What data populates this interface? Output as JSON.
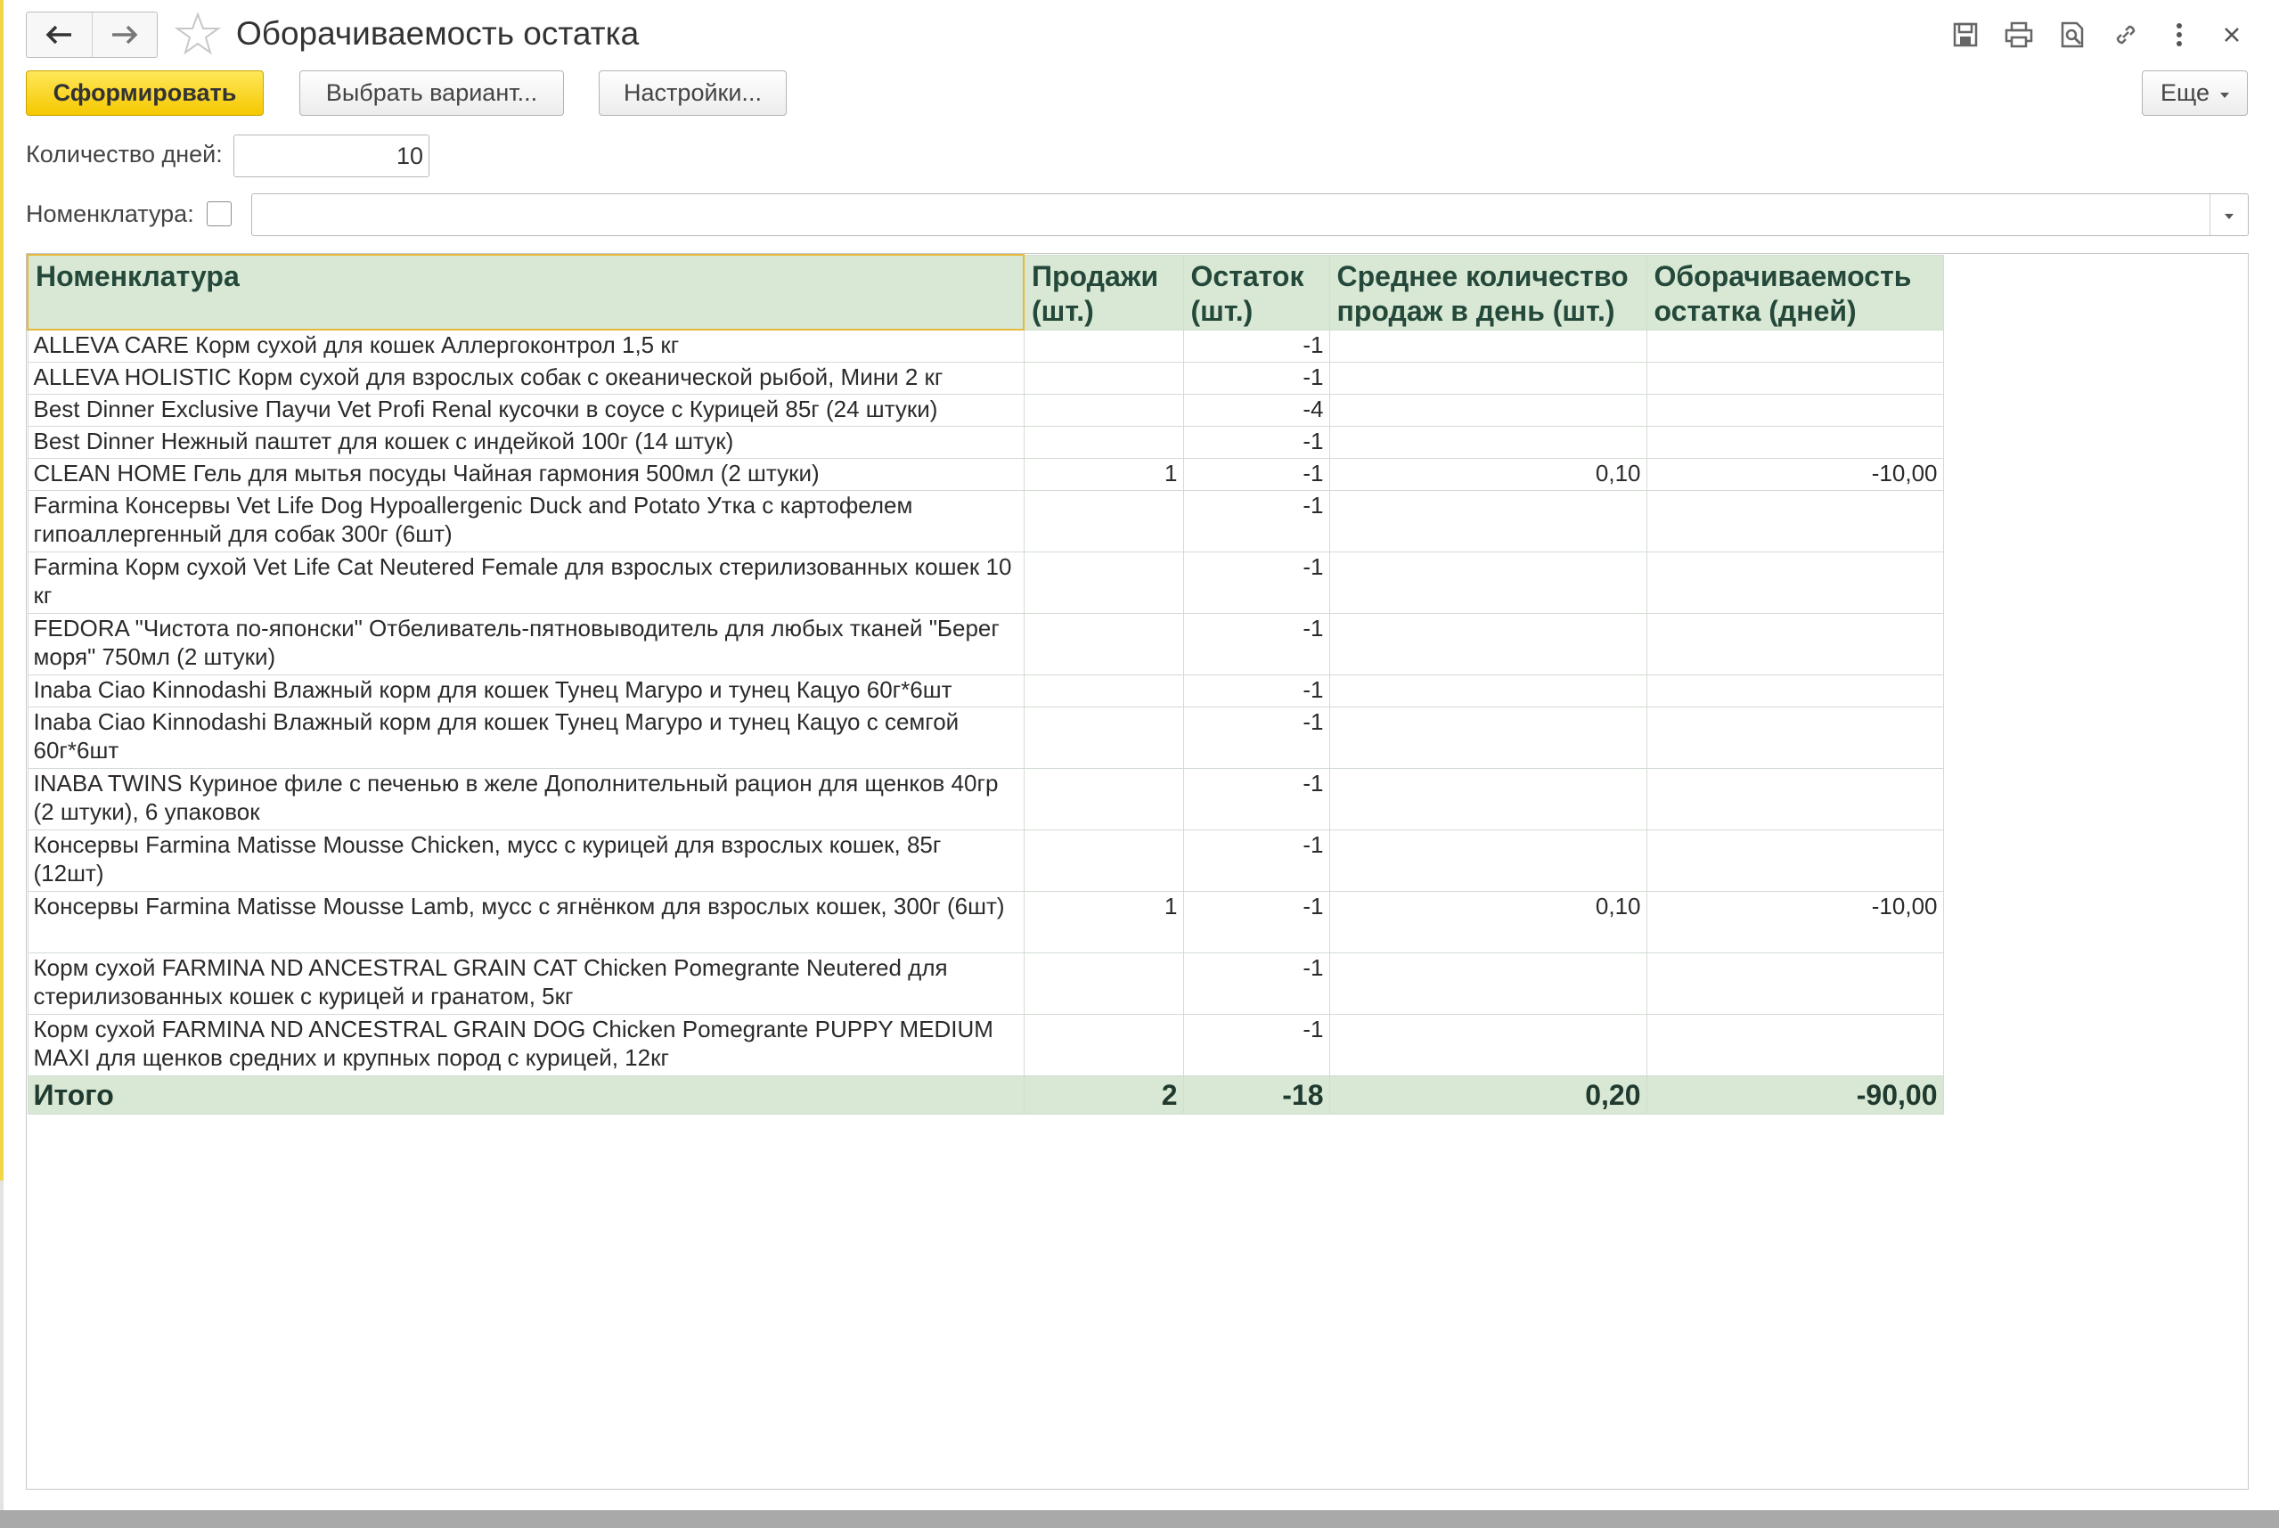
{
  "window": {
    "title": "Оборачиваемость остатка"
  },
  "toolbar": {
    "generate_label": "Сформировать",
    "variant_label": "Выбрать вариант...",
    "settings_label": "Настройки...",
    "more_label": "Еще"
  },
  "filters": {
    "days_label": "Количество дней:",
    "days_value": "10",
    "nomenclature_label": "Номенклатура:",
    "nomenclature_value": ""
  },
  "report": {
    "columns": {
      "name": "Номенклатура",
      "sales": "Продажи (шт.)",
      "stock": "Остаток (шт.)",
      "avg": "Среднее количество продаж в день (шт.)",
      "turnover": "Оборачиваемость остатка (дней)"
    },
    "rows": [
      {
        "name": "ALLEVA CARE Корм сухой для кошек Аллергоконтрол 1,5 кг",
        "sales": "",
        "stock": "-1",
        "avg": "",
        "turnover": ""
      },
      {
        "name": "ALLEVA HOLISTIC Корм сухой для взрослых собак с океанической рыбой, Мини 2 кг",
        "sales": "",
        "stock": "-1",
        "avg": "",
        "turnover": ""
      },
      {
        "name": "Best Dinner Exclusive Паучи Vet Profi Renal кусочки в соусе с Курицей 85г (24 штуки)",
        "sales": "",
        "stock": "-4",
        "avg": "",
        "turnover": ""
      },
      {
        "name": "Best Dinner Нежный паштет для кошек с индейкой 100г (14 штук)",
        "sales": "",
        "stock": "-1",
        "avg": "",
        "turnover": ""
      },
      {
        "name": "CLEAN HOME Гель для мытья посуды Чайная гармония 500мл (2 штуки)",
        "sales": "1",
        "stock": "-1",
        "avg": "0,10",
        "turnover": "-10,00"
      },
      {
        "name": "Farmina Консервы Vet Life Dog Hypoallergenic Duck and Potato Утка с картофелем гипоаллергенный для собак 300г (6шт)",
        "sales": "",
        "stock": "-1",
        "avg": "",
        "turnover": ""
      },
      {
        "name": "Farmina Корм сухой Vet Life Cat Neutered Female для взрослых стерилизованных кошек 10 кг",
        "sales": "",
        "stock": "-1",
        "avg": "",
        "turnover": ""
      },
      {
        "name": "FEDORA  \"Чистота по-японски\" Отбеливатель-пятновыводитель для любых тканей \"Берег моря\" 750мл (2 штуки)",
        "sales": "",
        "stock": "-1",
        "avg": "",
        "turnover": ""
      },
      {
        "name": "Inaba Ciao Kinnodashi Влажный корм для кошек Тунец Магуро и тунец Кацуо 60г*6шт",
        "sales": "",
        "stock": "-1",
        "avg": "",
        "turnover": ""
      },
      {
        "name": "Inaba Ciao Kinnodashi Влажный корм для кошек Тунец Магуро и тунец Кацуо с семгой 60г*6шт",
        "sales": "",
        "stock": "-1",
        "avg": "",
        "turnover": ""
      },
      {
        "name": "INABA TWINS Куриное филе с печенью в желе Дополнительный рацион для щенков 40гр (2 штуки), 6 упаковок",
        "sales": "",
        "stock": "-1",
        "avg": "",
        "turnover": ""
      },
      {
        "name": "Консервы Farmina Matisse Mousse Chicken, мусс с курицей для взрослых кошек, 85г (12шт)",
        "sales": "",
        "stock": "-1",
        "avg": "",
        "turnover": ""
      },
      {
        "name": "Консервы Farmina Matisse Mousse Lamb, мусс с ягнёнком для взрослых кошек, 300г (6шт)",
        "sales": "1",
        "stock": "-1",
        "avg": "0,10",
        "turnover": "-10,00"
      },
      {
        "name": "Корм сухой FARMINA ND ANCESTRAL GRAIN CAT Chicken Pomegrante Neutered для стерилизованных кошек с курицей и гранатом, 5кг",
        "sales": "",
        "stock": "-1",
        "avg": "",
        "turnover": ""
      },
      {
        "name": "Корм сухой FARMINA ND ANCESTRAL GRAIN DOG Chicken Pomegrante PUPPY MEDIUM MAXI для щенков средних и крупных пород с курицей, 12кг",
        "sales": "",
        "stock": "-1",
        "avg": "",
        "turnover": ""
      }
    ],
    "total": {
      "name": "Итого",
      "sales": "2",
      "stock": "-18",
      "avg": "0,20",
      "turnover": "-90,00"
    }
  },
  "icons": [
    "arrow-left-icon",
    "arrow-right-icon",
    "star-icon",
    "save-icon",
    "print-icon",
    "preview-icon",
    "link-icon",
    "more-vert-icon",
    "close-icon"
  ],
  "colors": {
    "accent": "#f5c800",
    "header_bg": "#d8e8d4",
    "header_text": "#24483a"
  }
}
